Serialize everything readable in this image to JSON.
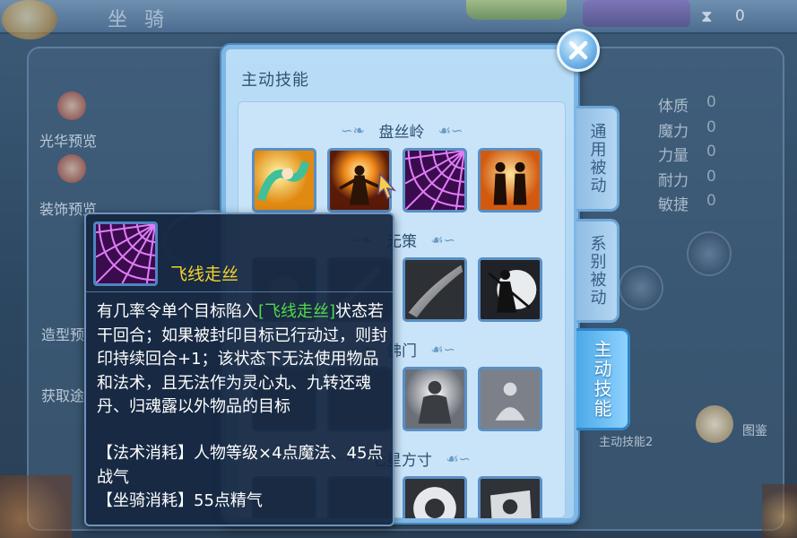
{
  "background": {
    "title": "坐  骑",
    "top_counter": "0",
    "side_items": [
      {
        "label": "光华预览"
      },
      {
        "label": "装饰预览"
      },
      {
        "label": "造型预"
      },
      {
        "label": "获取途"
      }
    ],
    "stats": [
      {
        "label": "体质",
        "value": "0"
      },
      {
        "label": "魔力",
        "value": "0"
      },
      {
        "label": "力量",
        "value": "0"
      },
      {
        "label": "耐力",
        "value": "0"
      },
      {
        "label": "敏捷",
        "value": "0"
      }
    ],
    "skill2_label": "主动技能2",
    "map_label": "图鉴"
  },
  "panel": {
    "title": "主动技能",
    "sections": [
      {
        "name": "盘丝岭"
      },
      {
        "name": "无策"
      },
      {
        "name": "佛门"
      },
      {
        "name": "七星方寸"
      }
    ]
  },
  "tabs": [
    {
      "label": "通用被动",
      "active": false
    },
    {
      "label": "系别被动",
      "active": false
    },
    {
      "label": "主动技能",
      "active": true
    }
  ],
  "tooltip": {
    "skill_name": "飞线走丝",
    "desc_prefix": "有几率令单个目标陷入",
    "desc_highlight": "[飞线走丝]",
    "desc_rest": "状态若干回合；如果被封印目标已行动过，则封印持续回合+1；该状态下无法使用物品和法术，且无法作为灵心丸、九转还魂丹、归魂露以外物品的目标",
    "cost_magic": "【法术消耗】人物等级×4点魔法、45点战气",
    "cost_mount": "【坐骑消耗】55点精气"
  },
  "colors": {
    "highlight_green": "#53d94c",
    "skill_name_yellow": "#f5d22e",
    "panel_bg": "#b9ddf7",
    "active_tab": "#4aa9e8"
  }
}
